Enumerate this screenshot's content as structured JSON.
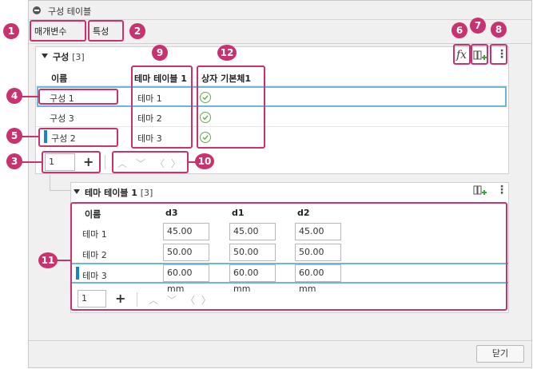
{
  "window": {
    "title": "구성 테이블"
  },
  "tabs": [
    {
      "label": "매개변수"
    },
    {
      "label": "특성"
    }
  ],
  "callouts": [
    "1",
    "2",
    "3",
    "4",
    "5",
    "6",
    "7",
    "8",
    "9",
    "10",
    "11",
    "12"
  ],
  "config_section": {
    "title": "구성",
    "count": "[3]",
    "columns": [
      "이름",
      "테마 테이블 1",
      "상자 기본체1"
    ],
    "rows": [
      {
        "name": "구성 1",
        "theme": "테마 1",
        "checked": true,
        "selected": true
      },
      {
        "name": "구성 3",
        "theme": "테마 2",
        "checked": true,
        "selected": false
      },
      {
        "name": "구성 2",
        "theme": "테마 3",
        "checked": true,
        "selected": false
      }
    ],
    "stepper_value": "1",
    "fx_label": "fx"
  },
  "theme_section": {
    "title": "테마 테이블 1",
    "count": "[3]",
    "columns": [
      "이름",
      "d3",
      "d1",
      "d2"
    ],
    "rows": [
      {
        "name": "테마 1",
        "d3": "45.00 mm",
        "d1": "45.00 mm",
        "d2": "45.00 mm"
      },
      {
        "name": "테마 2",
        "d3": "50.00 mm",
        "d1": "50.00 mm",
        "d2": "50.00 mm"
      },
      {
        "name": "테마 3",
        "d3": "60.00 mm",
        "d1": "60.00 mm",
        "d2": "60.00 mm"
      }
    ],
    "stepper_value": "1"
  },
  "footer": {
    "close_label": "닫기"
  },
  "colors": {
    "callout": "#c8326e",
    "selection": "#6bb7dc",
    "marker": "#1a85c6",
    "check": "#6aa84f"
  }
}
